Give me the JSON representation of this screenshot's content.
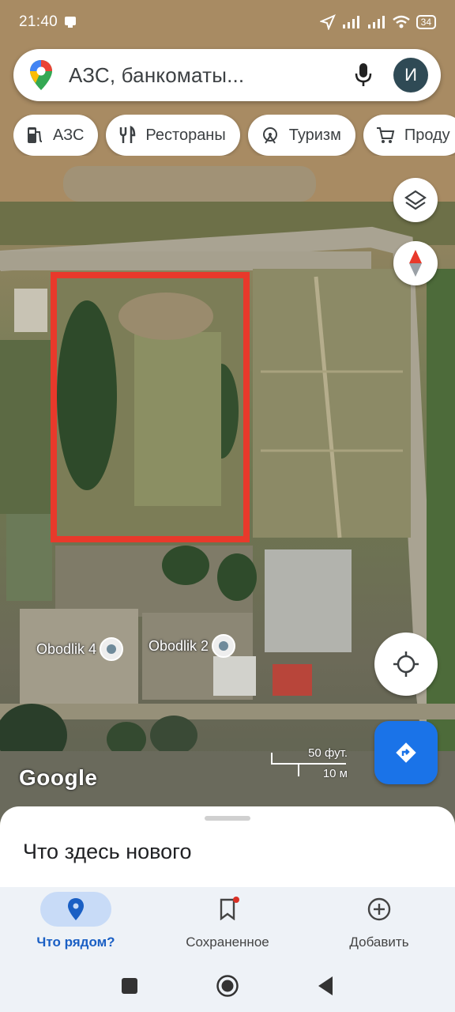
{
  "status_bar": {
    "time": "21:40",
    "battery": "34"
  },
  "search": {
    "placeholder": "АЗС, банкоматы...",
    "avatar_letter": "И"
  },
  "chips": [
    {
      "label": "АЗС",
      "icon": "gas-station-icon"
    },
    {
      "label": "Рестораны",
      "icon": "restaurant-icon"
    },
    {
      "label": "Туризм",
      "icon": "attraction-icon"
    },
    {
      "label": "Проду",
      "icon": "shopping-cart-icon"
    }
  ],
  "map": {
    "places": [
      {
        "label": "Obodlik 4"
      },
      {
        "label": "Obodlik 2"
      }
    ],
    "logo": "Google",
    "scale": {
      "imperial": "50 фут.",
      "metric": "10 м"
    },
    "highlight_color": "#e8392b"
  },
  "sheet": {
    "title": "Что здесь нового"
  },
  "bottom_nav": [
    {
      "label": "Что рядом?",
      "icon": "location-pin-icon",
      "active": true
    },
    {
      "label": "Сохраненное",
      "icon": "bookmark-icon",
      "active": false
    },
    {
      "label": "Добавить",
      "icon": "add-circle-icon",
      "active": false
    }
  ],
  "colors": {
    "accent": "#1a73e8",
    "active_nav": "#1a5fc4"
  }
}
